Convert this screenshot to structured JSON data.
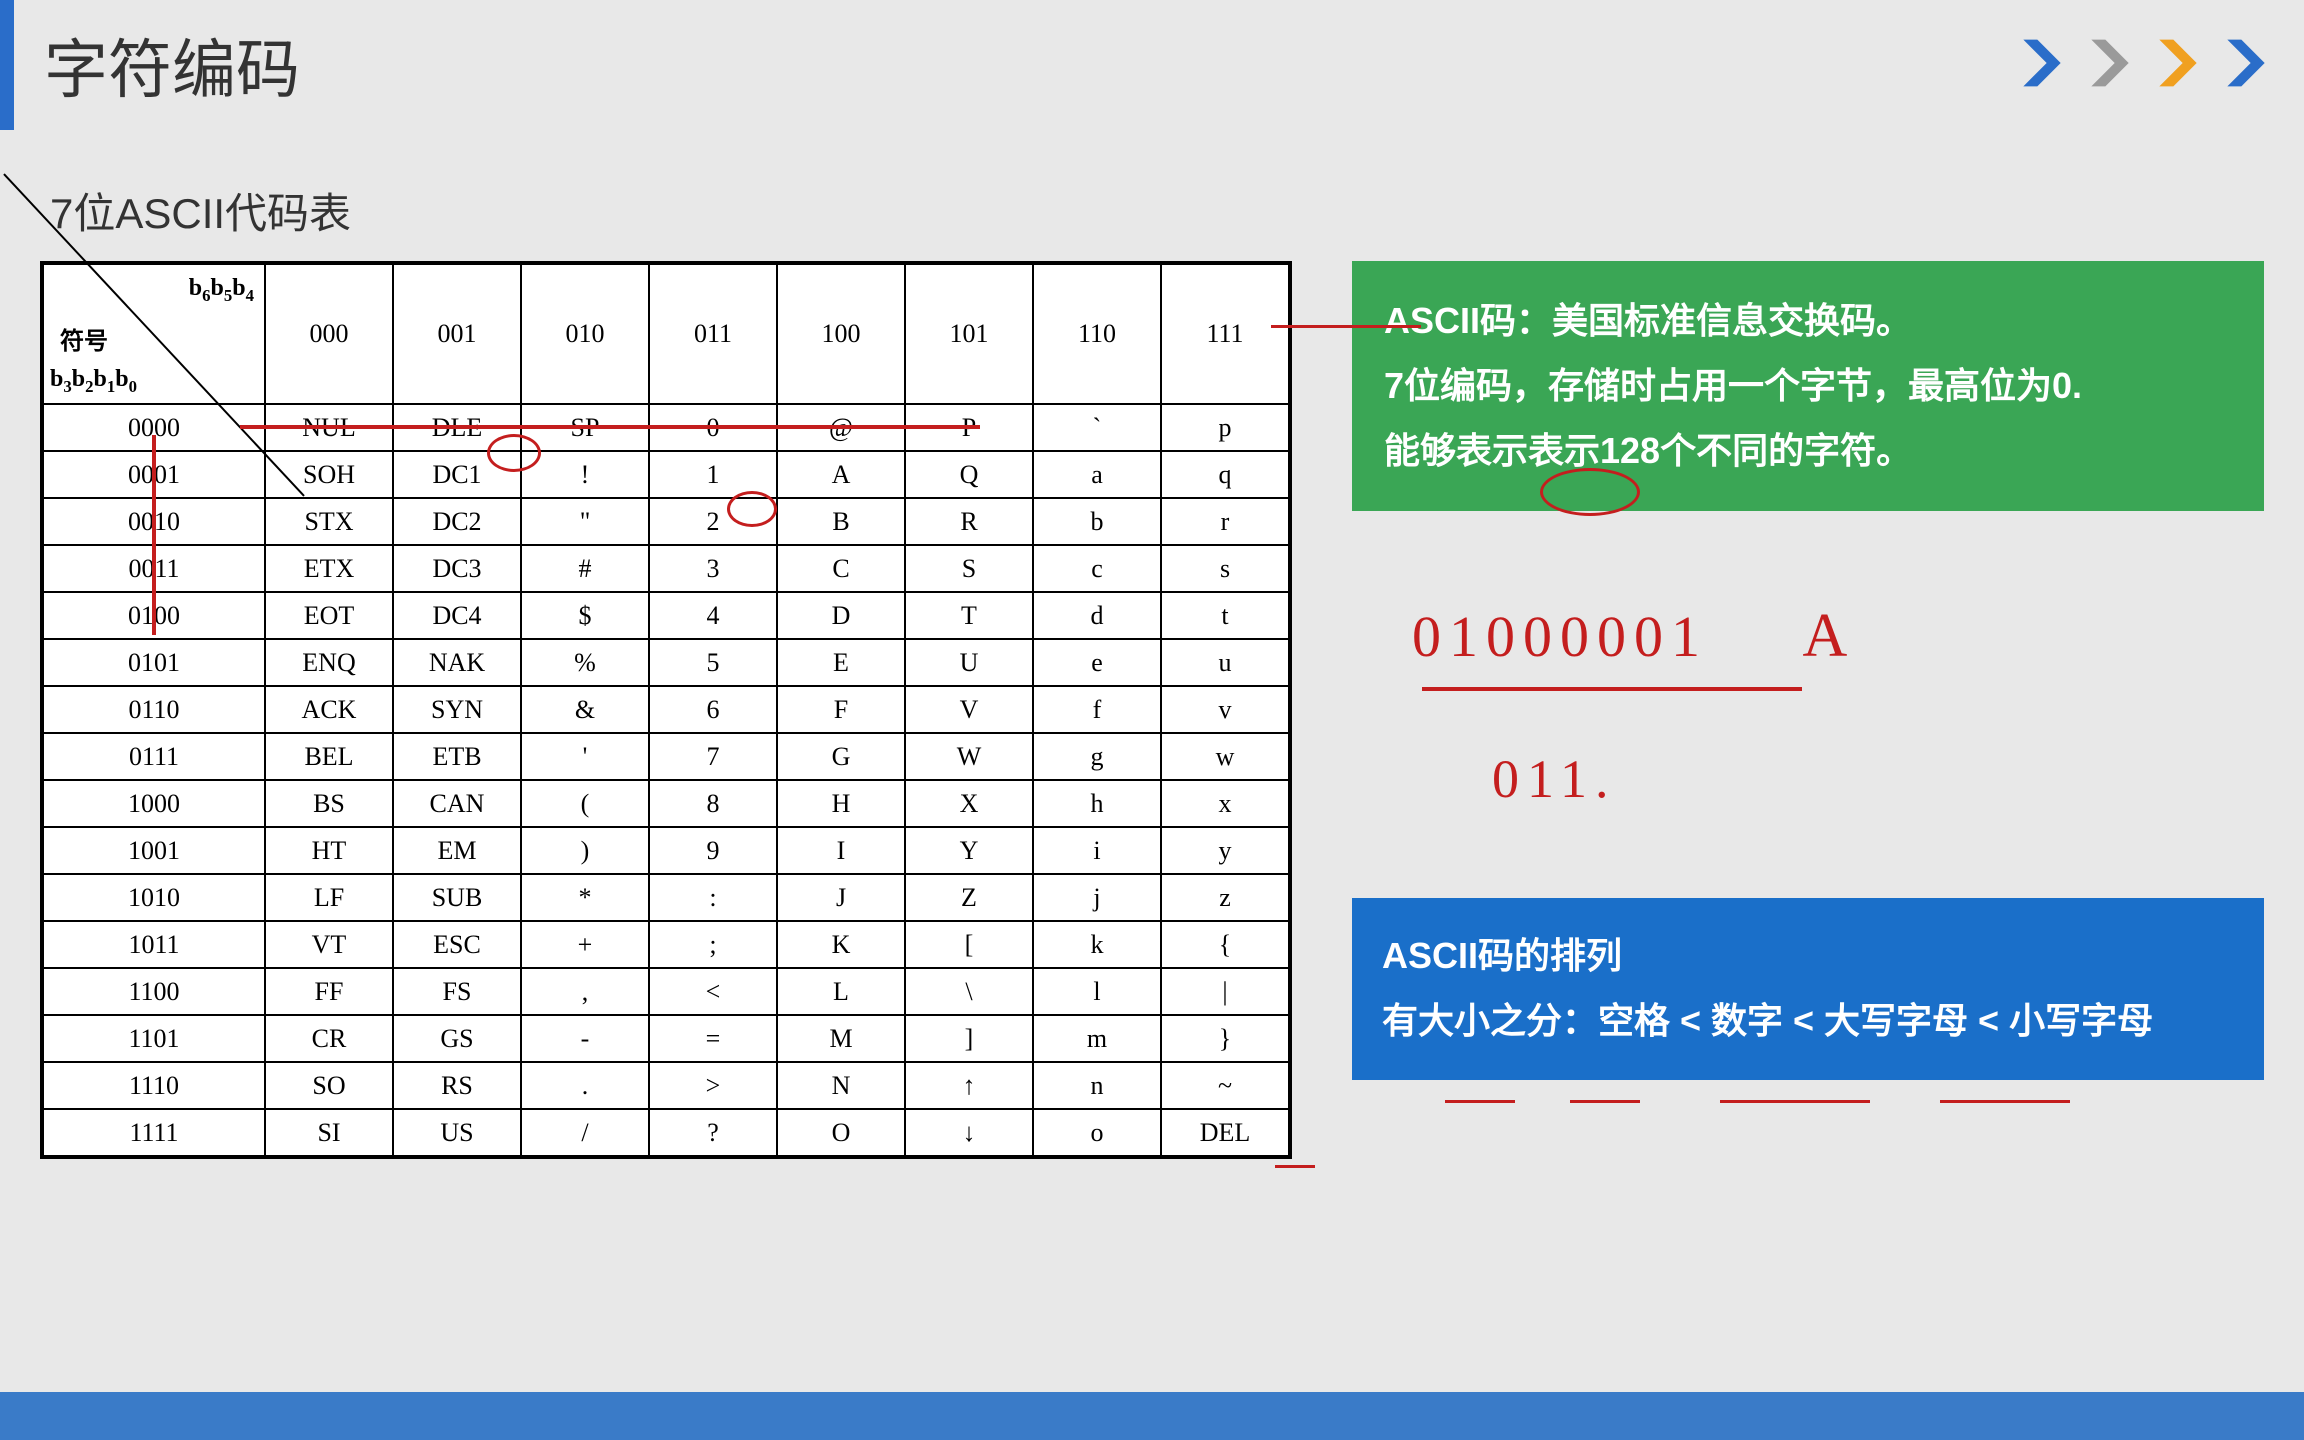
{
  "header": {
    "title": "字符编码"
  },
  "subtitle": "7位ASCII代码表",
  "table": {
    "corner_top": "b₆b₅b₄",
    "corner_mid": "符号",
    "corner_bot": "b₃b₂b₁b₀",
    "col_headers": [
      "000",
      "001",
      "010",
      "011",
      "100",
      "101",
      "110",
      "111"
    ],
    "rows": [
      {
        "head": "0000",
        "cells": [
          "NUL",
          "DLE",
          "SP",
          "0",
          "@",
          "P",
          "`",
          "p"
        ]
      },
      {
        "head": "0001",
        "cells": [
          "SOH",
          "DC1",
          "!",
          "1",
          "A",
          "Q",
          "a",
          "q"
        ]
      },
      {
        "head": "0010",
        "cells": [
          "STX",
          "DC2",
          "\"",
          "2",
          "B",
          "R",
          "b",
          "r"
        ]
      },
      {
        "head": "0011",
        "cells": [
          "ETX",
          "DC3",
          "#",
          "3",
          "C",
          "S",
          "c",
          "s"
        ]
      },
      {
        "head": "0100",
        "cells": [
          "EOT",
          "DC4",
          "$",
          "4",
          "D",
          "T",
          "d",
          "t"
        ]
      },
      {
        "head": "0101",
        "cells": [
          "ENQ",
          "NAK",
          "%",
          "5",
          "E",
          "U",
          "e",
          "u"
        ]
      },
      {
        "head": "0110",
        "cells": [
          "ACK",
          "SYN",
          "&",
          "6",
          "F",
          "V",
          "f",
          "v"
        ]
      },
      {
        "head": "0111",
        "cells": [
          "BEL",
          "ETB",
          "'",
          "7",
          "G",
          "W",
          "g",
          "w"
        ]
      },
      {
        "head": "1000",
        "cells": [
          "BS",
          "CAN",
          "(",
          "8",
          "H",
          "X",
          "h",
          "x"
        ]
      },
      {
        "head": "1001",
        "cells": [
          "HT",
          "EM",
          ")",
          "9",
          "I",
          "Y",
          "i",
          "y"
        ]
      },
      {
        "head": "1010",
        "cells": [
          "LF",
          "SUB",
          "*",
          ":",
          "J",
          "Z",
          "j",
          "z"
        ]
      },
      {
        "head": "1011",
        "cells": [
          "VT",
          "ESC",
          "+",
          ";",
          "K",
          "[",
          "k",
          "{"
        ]
      },
      {
        "head": "1100",
        "cells": [
          "FF",
          "FS",
          ",",
          "<",
          "L",
          "\\",
          "l",
          "|"
        ]
      },
      {
        "head": "1101",
        "cells": [
          "CR",
          "GS",
          "-",
          "=",
          "M",
          "]",
          "m",
          "}"
        ]
      },
      {
        "head": "1110",
        "cells": [
          "SO",
          "RS",
          ".",
          ">",
          "N",
          "↑",
          "n",
          "~"
        ]
      },
      {
        "head": "1111",
        "cells": [
          "SI",
          "US",
          "/",
          "?",
          "O",
          "↓",
          "o",
          "DEL"
        ]
      }
    ]
  },
  "green_box": {
    "line1": "ASCII码：美国标准信息交换码。",
    "line2": "7位编码，存储时占用一个字节，最高位为0.",
    "line3": "能够表示表示128个不同的字符。"
  },
  "handwritten": {
    "bits": "01000001",
    "char": "A",
    "partial": "011."
  },
  "blue_box": {
    "title": "ASCII码的排列",
    "body": "有大小之分：空格 < 数字 < 大写字母 < 小写字母"
  },
  "chevron_colors": [
    "#2a6dc9",
    "#9a9a9a",
    "#f0a020",
    "#2a6dc9"
  ]
}
